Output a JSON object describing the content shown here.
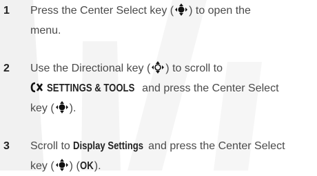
{
  "steps": [
    {
      "number": "1",
      "lines": [
        [
          "Press the Center Select key (",
          ") to open the"
        ],
        [
          "menu."
        ]
      ]
    },
    {
      "number": "2",
      "lines": [
        [
          "Use the Directional key (",
          ") to scroll to"
        ],
        [
          "SETTINGS & TOOLS",
          " and press the Center Select"
        ],
        [
          "key (",
          ")."
        ]
      ]
    },
    {
      "number": "3",
      "lines": [
        [
          "Scroll to ",
          "Display Settings",
          " and press the Center Select"
        ],
        [
          "key (",
          ") (",
          "OK",
          ")."
        ]
      ]
    }
  ],
  "icons": {
    "center_select": "center-select-key-icon",
    "directional": "directional-key-icon",
    "settings_tools": "settings-tools-icon"
  },
  "colors": {
    "text": "#4a4a4a",
    "heading": "#222222",
    "watermark": "#e4e4e4"
  }
}
